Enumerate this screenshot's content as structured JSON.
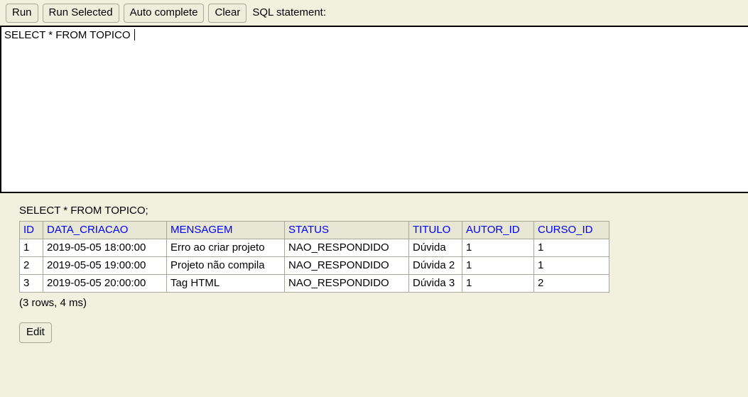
{
  "toolbar": {
    "buttons": [
      {
        "name": "run-button",
        "label": "Run"
      },
      {
        "name": "run-selected-button",
        "label": "Run Selected"
      },
      {
        "name": "auto-complete-button",
        "label": "Auto complete"
      },
      {
        "name": "clear-button",
        "label": "Clear"
      }
    ],
    "sql_statement_label": "SQL statement:"
  },
  "editor": {
    "value": "SELECT * FROM TOPICO ",
    "placeholder": ""
  },
  "result": {
    "query_echo": "SELECT * FROM TOPICO;",
    "columns": [
      "ID",
      "DATA_CRIACAO",
      "MENSAGEM",
      "STATUS",
      "TITULO",
      "AUTOR_ID",
      "CURSO_ID"
    ],
    "rows": [
      [
        "1",
        "2019-05-05 18:00:00",
        "Erro ao criar projeto",
        "NAO_RESPONDIDO",
        "Dúvida",
        "1",
        "1"
      ],
      [
        "2",
        "2019-05-05 19:00:00",
        "Projeto não compila",
        "NAO_RESPONDIDO",
        "Dúvida 2",
        "1",
        "1"
      ],
      [
        "3",
        "2019-05-05 20:00:00",
        "Tag HTML",
        "NAO_RESPONDIDO",
        "Dúvida 3",
        "1",
        "2"
      ]
    ],
    "status": "(3 rows, 4 ms)",
    "edit_label": "Edit"
  },
  "colors": {
    "page_background": "#f2f0de",
    "header_text": "#0000ff",
    "header_cell_background": "#e8e6d4",
    "cell_background": "#ffffff",
    "border": "#a9a799",
    "button_background": "#efeddc",
    "editor_border": "#000000"
  }
}
